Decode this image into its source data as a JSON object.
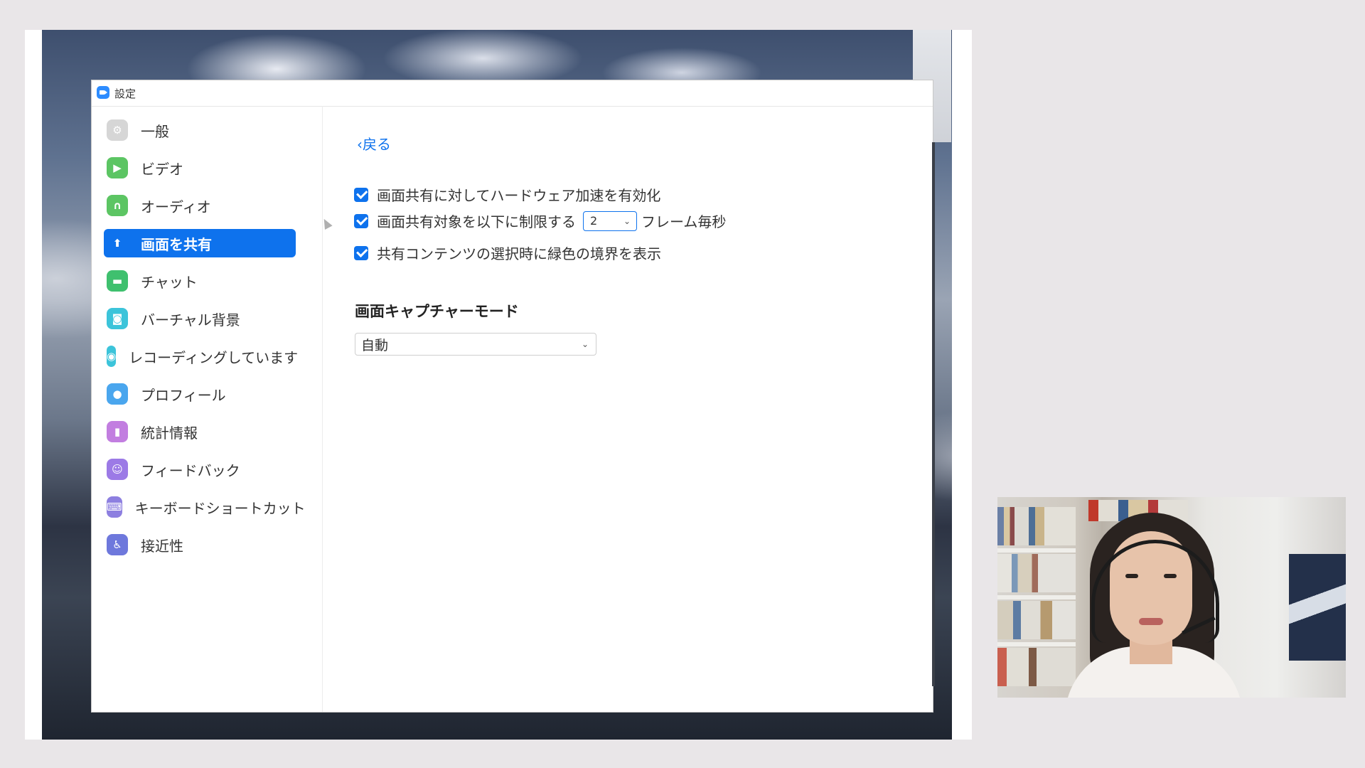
{
  "window": {
    "title": "設定"
  },
  "sidebar": {
    "items": [
      {
        "label": "一般",
        "icon": "gear-icon",
        "color": "#cfcfcf",
        "active": false
      },
      {
        "label": "ビデオ",
        "icon": "video-camera-icon",
        "color": "#5cc563",
        "active": false
      },
      {
        "label": "オーディオ",
        "icon": "headphones-icon",
        "color": "#5cc563",
        "active": false
      },
      {
        "label": "画面を共有",
        "icon": "share-screen-icon",
        "color": "#0e72ed",
        "active": true
      },
      {
        "label": "チャット",
        "icon": "chat-bubble-icon",
        "color": "#3fc06e",
        "active": false
      },
      {
        "label": "バーチャル背景",
        "icon": "person-background-icon",
        "color": "#3cc4da",
        "active": false
      },
      {
        "label": "レコーディングしています",
        "icon": "record-icon",
        "color": "#3cc4da",
        "active": false
      },
      {
        "label": "プロフィール",
        "icon": "profile-icon",
        "color": "#4aa6ee",
        "active": false
      },
      {
        "label": "統計情報",
        "icon": "bar-chart-icon",
        "color": "#c27ee0",
        "active": false
      },
      {
        "label": "フィードバック",
        "icon": "smile-icon",
        "color": "#9c7ae6",
        "active": false
      },
      {
        "label": "キーボードショートカット",
        "icon": "keyboard-icon",
        "color": "#8d7fe0",
        "active": false
      },
      {
        "label": "接近性",
        "icon": "accessibility-icon",
        "color": "#6e78dc",
        "active": false
      }
    ]
  },
  "content": {
    "back_label": "戻る",
    "options": [
      {
        "label": "画面共有に対してハードウェア加速を有効化",
        "checked": true
      },
      {
        "label": "画面共有対象を以下に制限する",
        "checked": true,
        "select_value": "2",
        "suffix": "フレーム毎秒"
      },
      {
        "label": "共有コンテンツの選択時に緑色の境界を表示",
        "checked": true
      }
    ],
    "capture_mode_title": "画面キャプチャーモード",
    "capture_mode_value": "自動"
  },
  "colors": {
    "accent": "#0e72ed"
  }
}
